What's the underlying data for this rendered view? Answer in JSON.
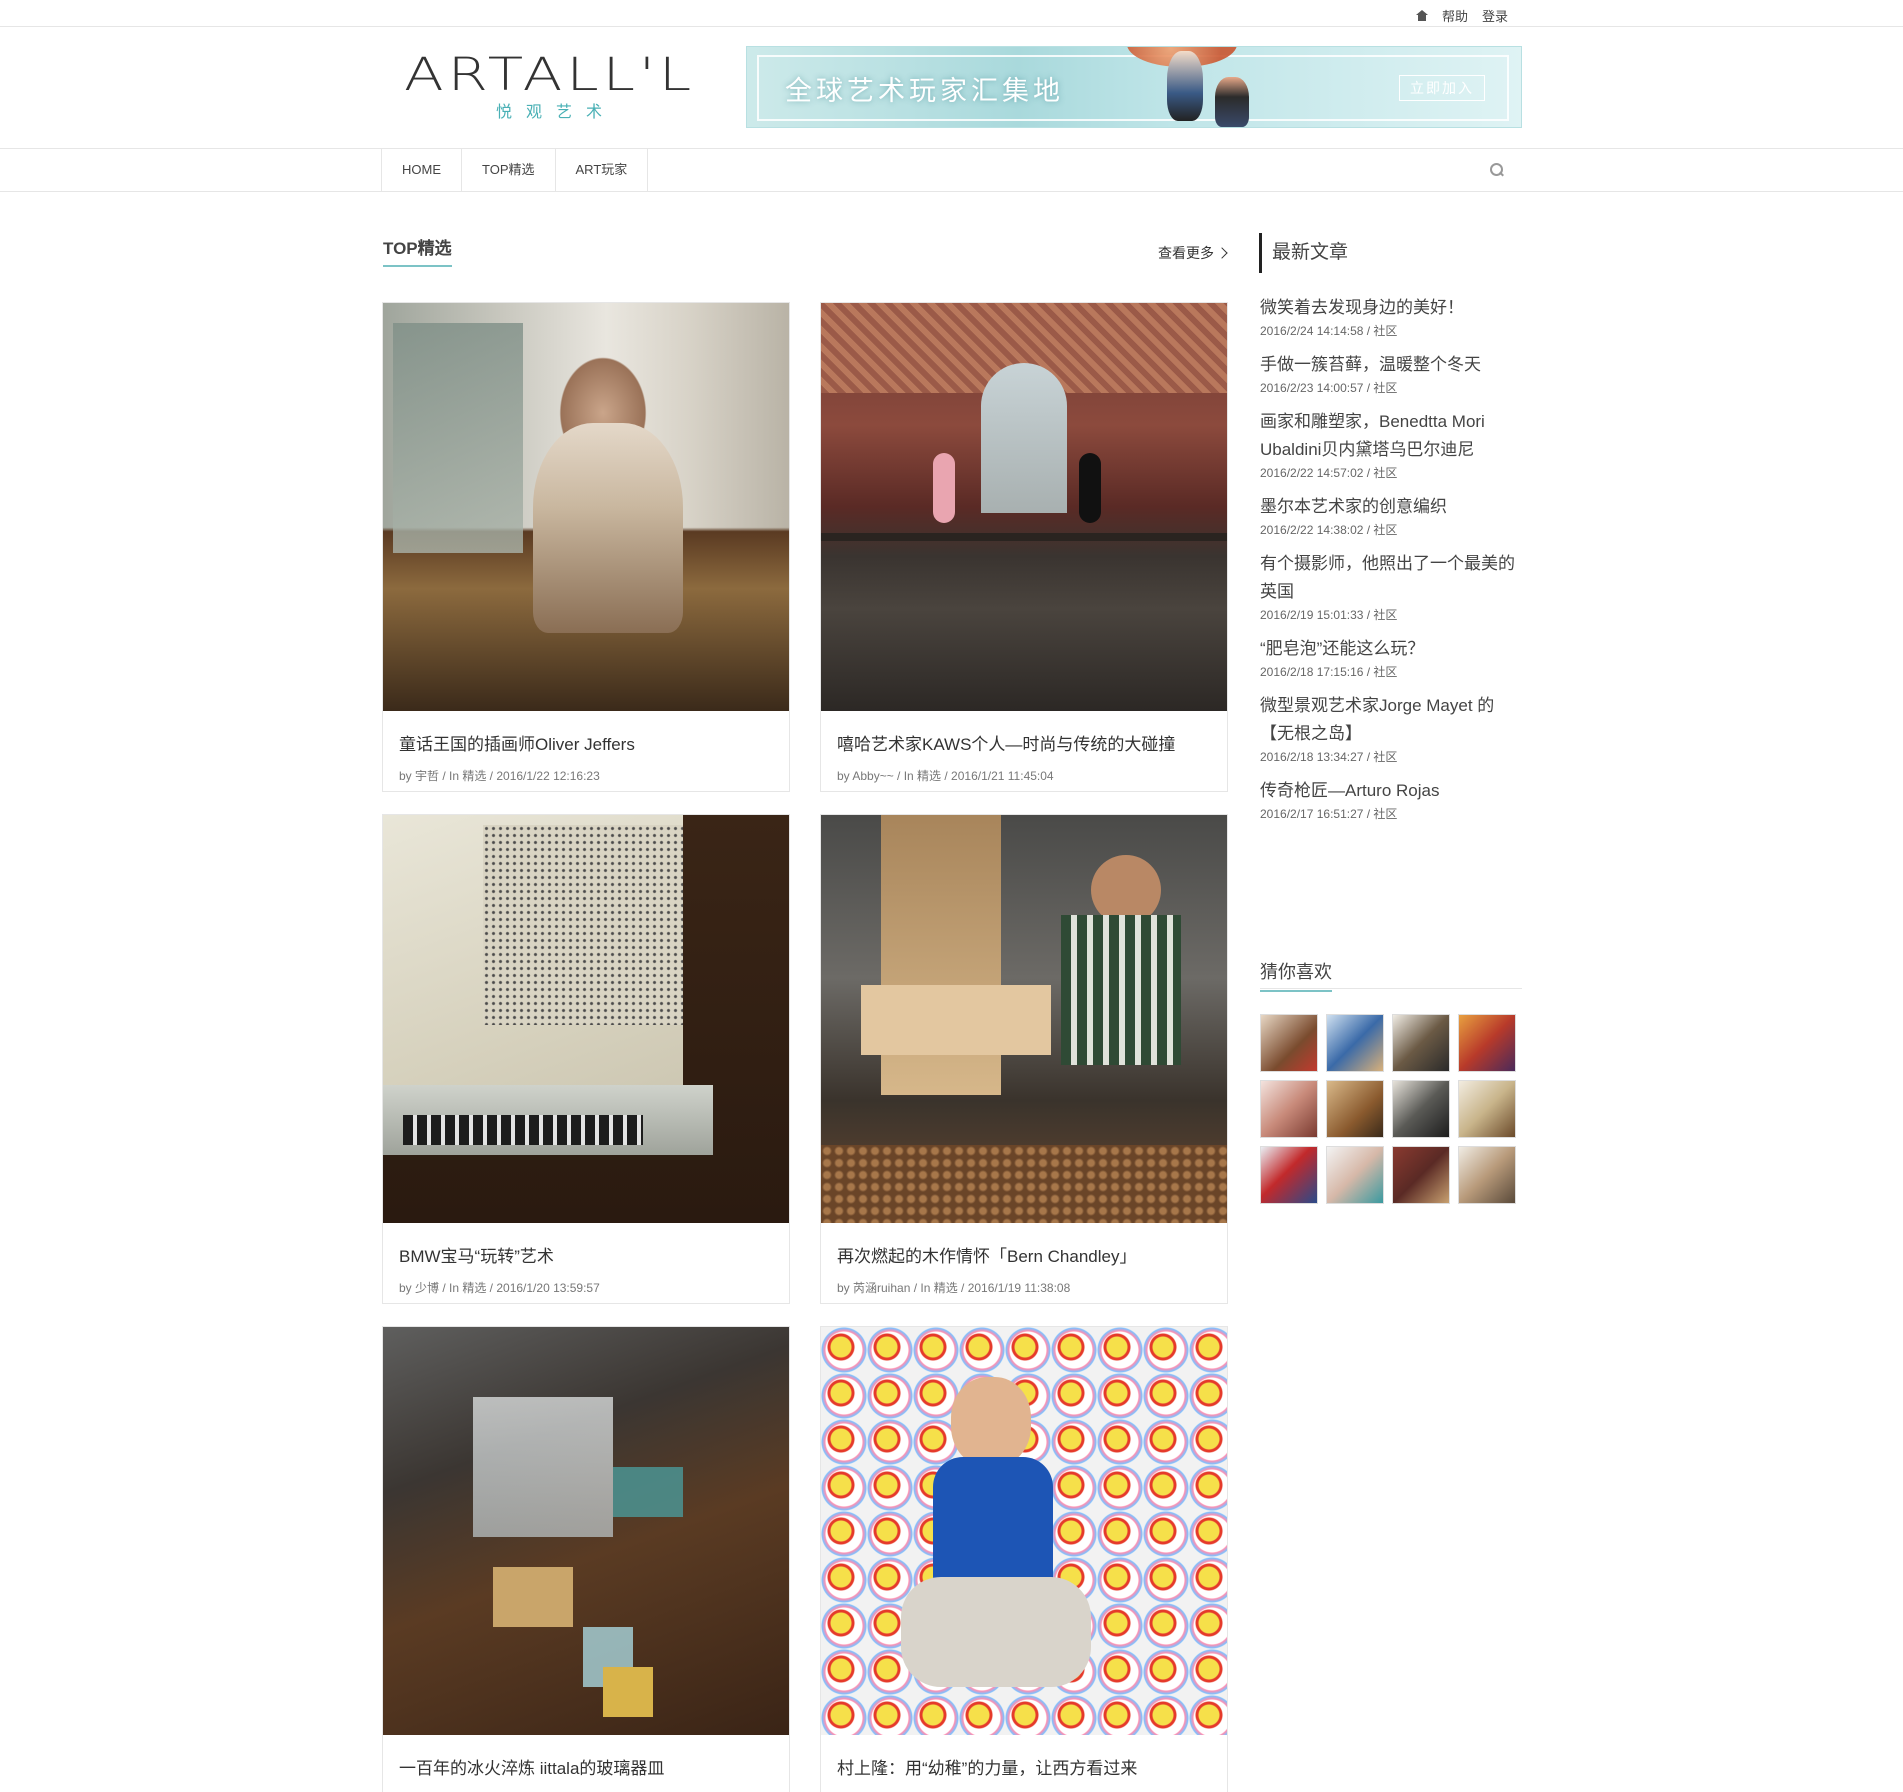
{
  "topbar": {
    "help": "帮助",
    "login": "登录"
  },
  "logo": {
    "main": "ARTALL'L",
    "sub": "悦观艺术"
  },
  "banner": {
    "slogan": "全球艺术玩家汇集地",
    "button": "立即加入"
  },
  "nav": {
    "items": [
      "HOME",
      "TOP精选",
      "ART玩家"
    ]
  },
  "section": {
    "title": "TOP精选",
    "more": "查看更多"
  },
  "cards": [
    {
      "title": "童话王国的插画师Oliver Jeffers",
      "meta": "by 宇哲 / In 精选 / 2016/1/22 12:16:23"
    },
    {
      "title": "嘻哈艺术家KAWS个人—时尚与传统的大碰撞",
      "meta": "by Abby~~ / In 精选 / 2016/1/21 11:45:04"
    },
    {
      "title": "BMW宝马“玩转”艺术",
      "meta": "by 少博 / In 精选 / 2016/1/20 13:59:57"
    },
    {
      "title": "再次燃起的木作情怀「Bern Chandley」",
      "meta": "by 芮涵ruihan / In 精选 / 2016/1/19 11:38:08"
    },
    {
      "title": "一百年的冰火淬炼 iittala的玻璃器皿",
      "meta": ""
    },
    {
      "title": "村上隆：用“幼稚”的力量，让西方看过来",
      "meta": ""
    }
  ],
  "sidebar": {
    "latest_title": "最新文章",
    "latest": [
      {
        "title": "微笑着去发现身边的美好！",
        "date": "2016/2/24 14:14:58 / 社区"
      },
      {
        "title": "手做一簇苔藓，温暖整个冬天",
        "date": "2016/2/23 14:00:57 / 社区"
      },
      {
        "title": "画家和雕塑家，Benedtta Mori Ubaldini贝内黛塔乌巴尔迪尼",
        "date": "2016/2/22 14:57:02 / 社区"
      },
      {
        "title": "墨尔本艺术家的创意编织",
        "date": "2016/2/22 14:38:02 / 社区"
      },
      {
        "title": "有个摄影师，他照出了一个最美的英国",
        "date": "2016/2/19 15:01:33 / 社区"
      },
      {
        "title": "“肥皂泡”还能这么玩？",
        "date": "2016/2/18 17:15:16 / 社区"
      },
      {
        "title": "微型景观艺术家Jorge Mayet 的【无根之岛】",
        "date": "2016/2/18 13:34:27 / 社区"
      },
      {
        "title": "传奇枪匠—Arturo Rojas",
        "date": "2016/2/17 16:51:27 / 社区"
      }
    ],
    "guess_title": "猜你喜欢"
  }
}
